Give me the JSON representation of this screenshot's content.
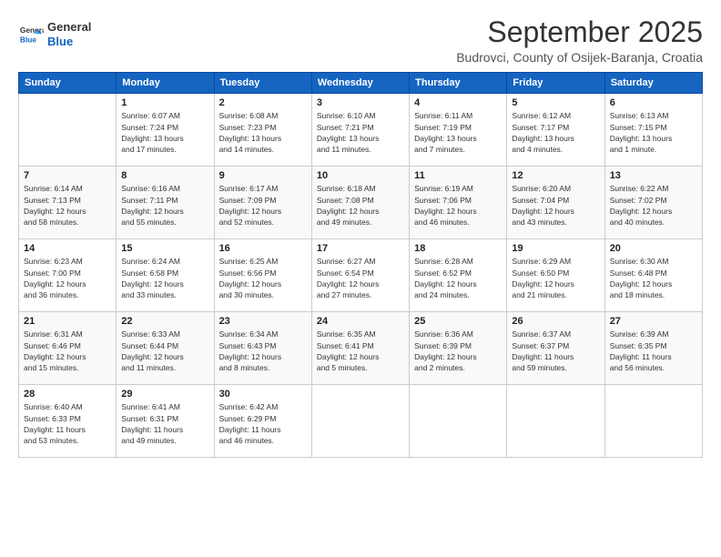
{
  "logo": {
    "line1": "General",
    "line2": "Blue"
  },
  "title": "September 2025",
  "location": "Budrovci, County of Osijek-Baranja, Croatia",
  "headers": [
    "Sunday",
    "Monday",
    "Tuesday",
    "Wednesday",
    "Thursday",
    "Friday",
    "Saturday"
  ],
  "weeks": [
    [
      {
        "day": "",
        "info": ""
      },
      {
        "day": "1",
        "info": "Sunrise: 6:07 AM\nSunset: 7:24 PM\nDaylight: 13 hours\nand 17 minutes."
      },
      {
        "day": "2",
        "info": "Sunrise: 6:08 AM\nSunset: 7:23 PM\nDaylight: 13 hours\nand 14 minutes."
      },
      {
        "day": "3",
        "info": "Sunrise: 6:10 AM\nSunset: 7:21 PM\nDaylight: 13 hours\nand 11 minutes."
      },
      {
        "day": "4",
        "info": "Sunrise: 6:11 AM\nSunset: 7:19 PM\nDaylight: 13 hours\nand 7 minutes."
      },
      {
        "day": "5",
        "info": "Sunrise: 6:12 AM\nSunset: 7:17 PM\nDaylight: 13 hours\nand 4 minutes."
      },
      {
        "day": "6",
        "info": "Sunrise: 6:13 AM\nSunset: 7:15 PM\nDaylight: 13 hours\nand 1 minute."
      }
    ],
    [
      {
        "day": "7",
        "info": "Sunrise: 6:14 AM\nSunset: 7:13 PM\nDaylight: 12 hours\nand 58 minutes."
      },
      {
        "day": "8",
        "info": "Sunrise: 6:16 AM\nSunset: 7:11 PM\nDaylight: 12 hours\nand 55 minutes."
      },
      {
        "day": "9",
        "info": "Sunrise: 6:17 AM\nSunset: 7:09 PM\nDaylight: 12 hours\nand 52 minutes."
      },
      {
        "day": "10",
        "info": "Sunrise: 6:18 AM\nSunset: 7:08 PM\nDaylight: 12 hours\nand 49 minutes."
      },
      {
        "day": "11",
        "info": "Sunrise: 6:19 AM\nSunset: 7:06 PM\nDaylight: 12 hours\nand 46 minutes."
      },
      {
        "day": "12",
        "info": "Sunrise: 6:20 AM\nSunset: 7:04 PM\nDaylight: 12 hours\nand 43 minutes."
      },
      {
        "day": "13",
        "info": "Sunrise: 6:22 AM\nSunset: 7:02 PM\nDaylight: 12 hours\nand 40 minutes."
      }
    ],
    [
      {
        "day": "14",
        "info": "Sunrise: 6:23 AM\nSunset: 7:00 PM\nDaylight: 12 hours\nand 36 minutes."
      },
      {
        "day": "15",
        "info": "Sunrise: 6:24 AM\nSunset: 6:58 PM\nDaylight: 12 hours\nand 33 minutes."
      },
      {
        "day": "16",
        "info": "Sunrise: 6:25 AM\nSunset: 6:56 PM\nDaylight: 12 hours\nand 30 minutes."
      },
      {
        "day": "17",
        "info": "Sunrise: 6:27 AM\nSunset: 6:54 PM\nDaylight: 12 hours\nand 27 minutes."
      },
      {
        "day": "18",
        "info": "Sunrise: 6:28 AM\nSunset: 6:52 PM\nDaylight: 12 hours\nand 24 minutes."
      },
      {
        "day": "19",
        "info": "Sunrise: 6:29 AM\nSunset: 6:50 PM\nDaylight: 12 hours\nand 21 minutes."
      },
      {
        "day": "20",
        "info": "Sunrise: 6:30 AM\nSunset: 6:48 PM\nDaylight: 12 hours\nand 18 minutes."
      }
    ],
    [
      {
        "day": "21",
        "info": "Sunrise: 6:31 AM\nSunset: 6:46 PM\nDaylight: 12 hours\nand 15 minutes."
      },
      {
        "day": "22",
        "info": "Sunrise: 6:33 AM\nSunset: 6:44 PM\nDaylight: 12 hours\nand 11 minutes."
      },
      {
        "day": "23",
        "info": "Sunrise: 6:34 AM\nSunset: 6:43 PM\nDaylight: 12 hours\nand 8 minutes."
      },
      {
        "day": "24",
        "info": "Sunrise: 6:35 AM\nSunset: 6:41 PM\nDaylight: 12 hours\nand 5 minutes."
      },
      {
        "day": "25",
        "info": "Sunrise: 6:36 AM\nSunset: 6:39 PM\nDaylight: 12 hours\nand 2 minutes."
      },
      {
        "day": "26",
        "info": "Sunrise: 6:37 AM\nSunset: 6:37 PM\nDaylight: 11 hours\nand 59 minutes."
      },
      {
        "day": "27",
        "info": "Sunrise: 6:39 AM\nSunset: 6:35 PM\nDaylight: 11 hours\nand 56 minutes."
      }
    ],
    [
      {
        "day": "28",
        "info": "Sunrise: 6:40 AM\nSunset: 6:33 PM\nDaylight: 11 hours\nand 53 minutes."
      },
      {
        "day": "29",
        "info": "Sunrise: 6:41 AM\nSunset: 6:31 PM\nDaylight: 11 hours\nand 49 minutes."
      },
      {
        "day": "30",
        "info": "Sunrise: 6:42 AM\nSunset: 6:29 PM\nDaylight: 11 hours\nand 46 minutes."
      },
      {
        "day": "",
        "info": ""
      },
      {
        "day": "",
        "info": ""
      },
      {
        "day": "",
        "info": ""
      },
      {
        "day": "",
        "info": ""
      }
    ]
  ]
}
